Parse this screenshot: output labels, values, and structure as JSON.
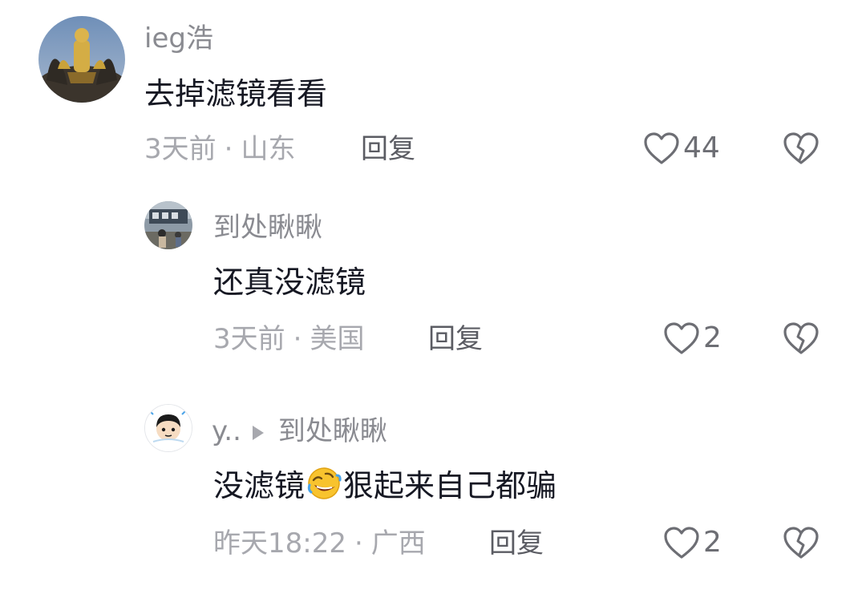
{
  "comments": [
    {
      "username": "ieg浩",
      "content": "去掉滤镜看看",
      "time": "3天前",
      "location": "山东",
      "reply_label": "回复",
      "likes": "44"
    }
  ],
  "replies": [
    {
      "username": "到处瞅瞅",
      "content": "还真没滤镜",
      "time": "3天前",
      "location": "美国",
      "reply_label": "回复",
      "likes": "2"
    },
    {
      "username": "y..",
      "reply_to": "到处瞅瞅",
      "content_before": "没滤镜",
      "emoji": "rofl-emoji",
      "content_after": "狠起来自己都骗",
      "time": "昨天18:22",
      "location": "广西",
      "reply_label": "回复",
      "likes": "2"
    }
  ],
  "meta_separator": "·",
  "colors": {
    "text_primary": "#161823",
    "text_secondary": "#8a8b91",
    "text_meta": "#a7a8ae",
    "icon": "#6d6e74"
  }
}
